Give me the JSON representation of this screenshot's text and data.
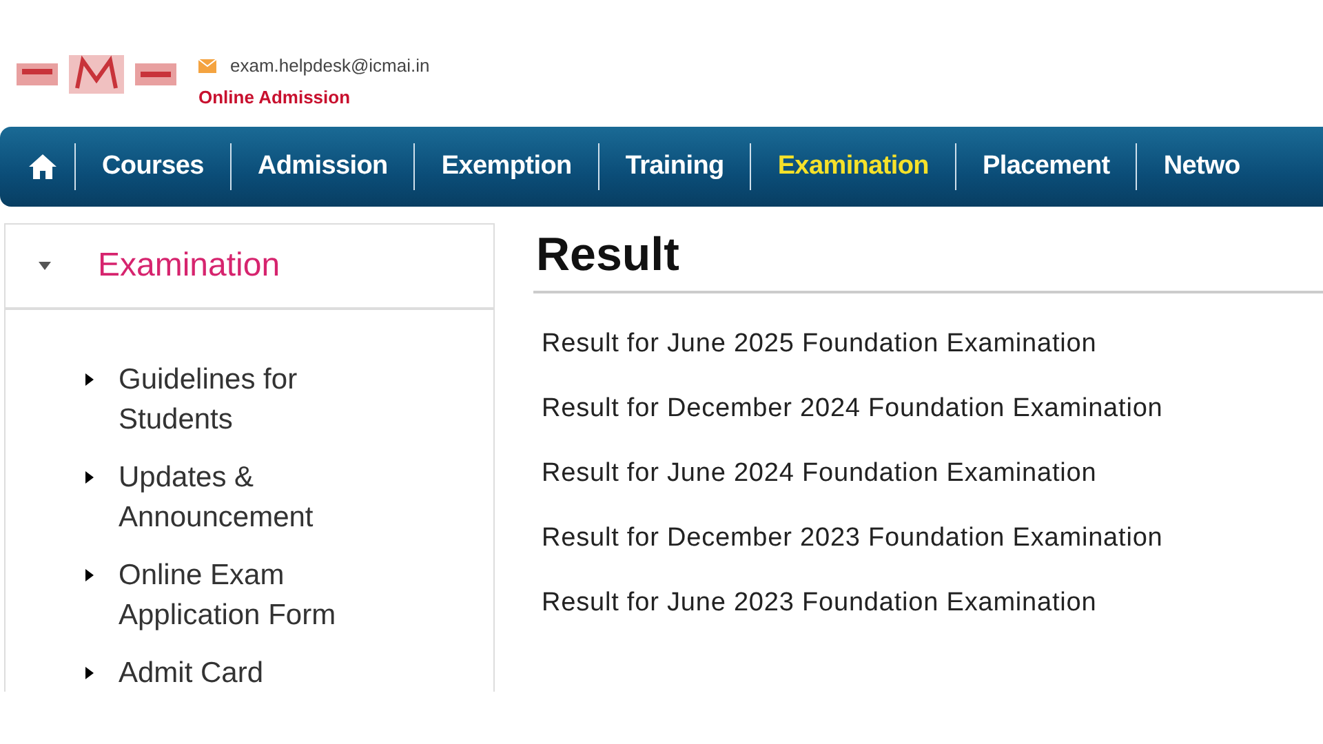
{
  "header": {
    "email": "exam.helpdesk@icmai.in",
    "subtitle": "Online Admission"
  },
  "nav": [
    {
      "label": "Courses",
      "selected": false
    },
    {
      "label": "Admission",
      "selected": false
    },
    {
      "label": "Exemption",
      "selected": false
    },
    {
      "label": "Training",
      "selected": false
    },
    {
      "label": "Examination",
      "selected": true
    },
    {
      "label": "Placement",
      "selected": false
    },
    {
      "label": "Netwo",
      "selected": false
    }
  ],
  "sidebar": {
    "title": "Examination",
    "expanded": true,
    "items": [
      {
        "label": "Guidelines for Students"
      },
      {
        "label": "Updates & Announcement"
      },
      {
        "label": "Online Exam Application Form"
      },
      {
        "label": "Admit Card"
      }
    ]
  },
  "content": {
    "title": "Result",
    "links": [
      "Result for June 2025 Foundation Examination",
      "Result for December 2024 Foundation Examination",
      "Result for June 2024 Foundation Examination",
      "Result for December 2023 Foundation Examination",
      "Result for June 2023 Foundation Examination"
    ]
  }
}
